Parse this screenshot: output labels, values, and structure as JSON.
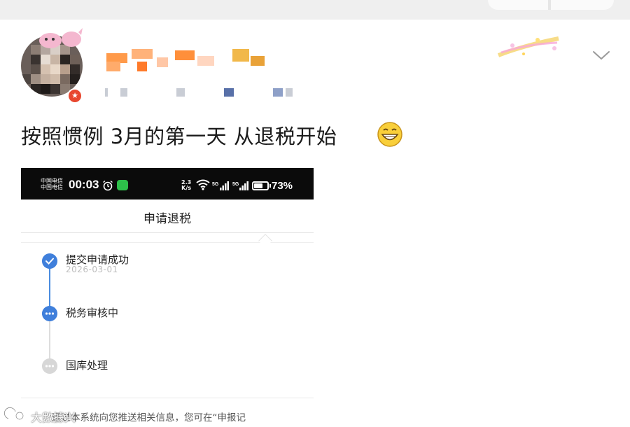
{
  "post": {
    "text": "按照惯例 3月的第一天 从退税开始",
    "emoji": "grinning-face-emoji"
  },
  "author": {
    "avatar": "pixelated-avatar",
    "badge_icon": "vip-star-icon"
  },
  "screenshot": {
    "status_bar": {
      "carrier_1": "中国电信",
      "carrier_2": "中国电信",
      "time": "00:03",
      "net_speed_value": "2.3",
      "net_speed_unit": "K/s",
      "signal_1_label": "5G",
      "signal_2_label": "5G",
      "battery_percent": "73%",
      "battery_level": 0.73
    },
    "title": "申请退税",
    "steps": [
      {
        "label": "提交申请成功",
        "date": "2026-03-01",
        "status": "done"
      },
      {
        "label": "税务审核中",
        "status": "in-progress"
      },
      {
        "label": "国库处理",
        "status": "pending"
      }
    ],
    "footer_notice": "通过本系统向您推送相关信息，您可在“申报记"
  },
  "watermark": {
    "text": "大數據兴"
  },
  "colors": {
    "accent_blue": "#3f7fdb",
    "pending_grey": "#d7d7d7",
    "badge_red": "#e8472f",
    "status_bar_bg": "#0b0b0b"
  }
}
